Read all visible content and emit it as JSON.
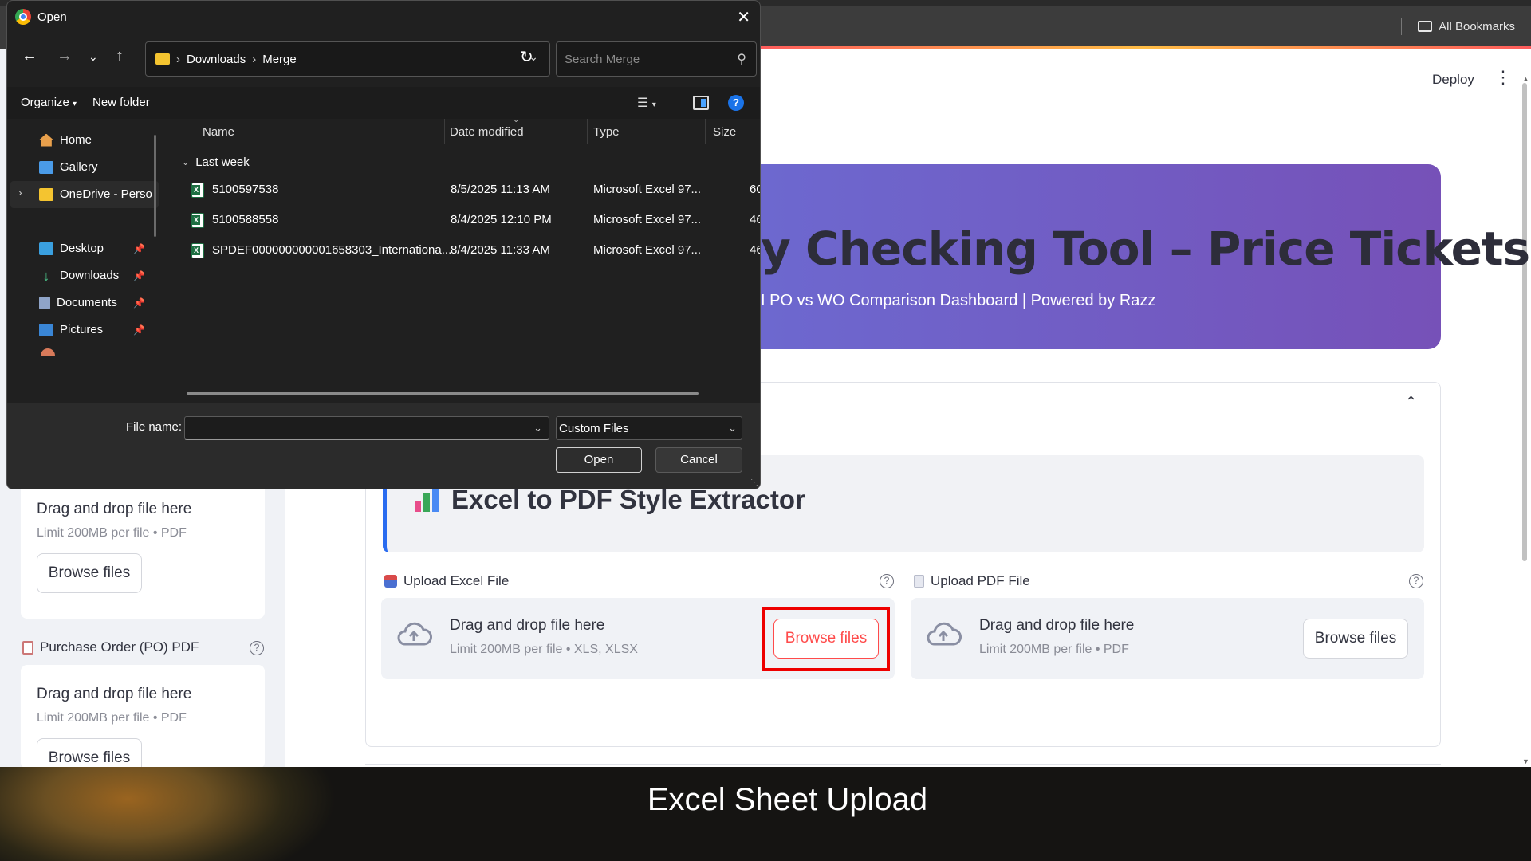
{
  "browser": {
    "bookmarks_label": "All Bookmarks"
  },
  "app": {
    "deploy_label": "Deploy",
    "hero": {
      "title": "y Checking Tool – Price Tickets",
      "subtitle": "I PO vs WO Comparison Dashboard | Powered by Razz"
    },
    "section_title": "Excel to PDF Style Extractor",
    "uploaders": [
      {
        "label": "Upload Excel File",
        "drag_text": "Drag and drop file here",
        "limit_text": "Limit 200MB per file • XLS, XLSX",
        "button": "Browse files"
      },
      {
        "label": "Upload PDF File",
        "drag_text": "Drag and drop file here",
        "limit_text": "Limit 200MB per file • PDF",
        "button": "Browse files"
      }
    ],
    "sidebar": {
      "card1": {
        "drag_text": "Drag and drop file here",
        "limit_text": "Limit 200MB per file • PDF",
        "button": "Browse files"
      },
      "po_label": "Purchase Order (PO) PDF",
      "card2": {
        "drag_text": "Drag and drop file here",
        "limit_text": "Limit 200MB per file • PDF",
        "button": "Browse files"
      }
    },
    "help_glyph": "?",
    "colors": {
      "highlight": "#ee0000",
      "primary": "#ff4b4b",
      "accent_bar": "#2a6cf0"
    }
  },
  "dialog": {
    "title": "Open",
    "breadcrumb": [
      "Downloads",
      "Merge"
    ],
    "search_placeholder": "Search Merge",
    "toolbar": {
      "organize": "Organize",
      "new_folder": "New folder"
    },
    "nav": {
      "home": "Home",
      "gallery": "Gallery",
      "onedrive": "OneDrive - Perso",
      "desktop": "Desktop",
      "downloads": "Downloads",
      "documents": "Documents",
      "pictures": "Pictures"
    },
    "columns": {
      "name": "Name",
      "date": "Date modified",
      "type": "Type",
      "size": "Size"
    },
    "group": "Last week",
    "files": [
      {
        "name": "5100597538",
        "date": "8/5/2025 11:13 AM",
        "type": "Microsoft Excel 97...",
        "size": "60"
      },
      {
        "name": "5100588558",
        "date": "8/4/2025 12:10 PM",
        "type": "Microsoft Excel 97...",
        "size": "46"
      },
      {
        "name": "SPDEF000000000001658303_Internationa...",
        "date": "8/4/2025 11:33 AM",
        "type": "Microsoft Excel 97...",
        "size": "46"
      }
    ],
    "file_name_label": "File name:",
    "file_name_value": "",
    "file_type": "Custom Files",
    "open_button": "Open",
    "cancel_button": "Cancel"
  },
  "caption": "Excel Sheet Upload"
}
